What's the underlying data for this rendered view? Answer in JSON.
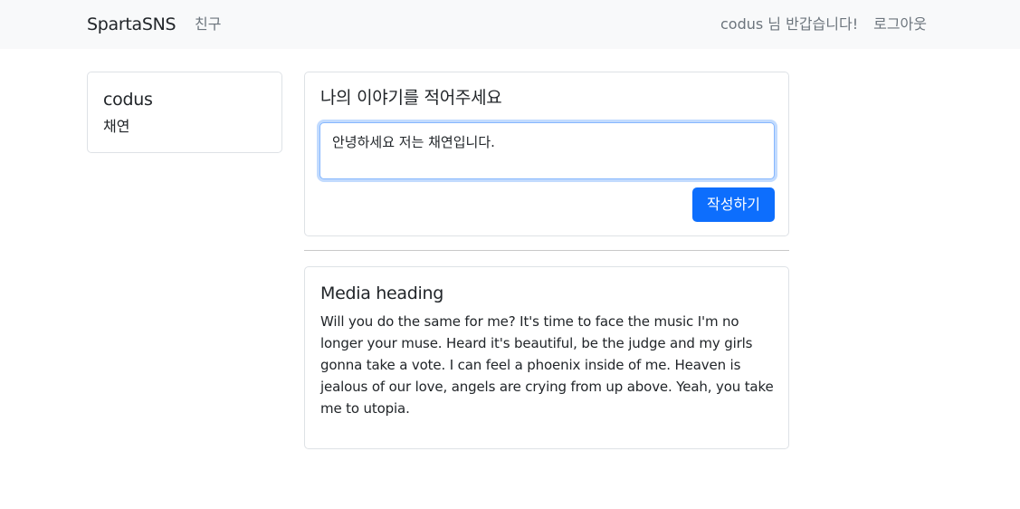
{
  "navbar": {
    "brand": "SpartaSNS",
    "friends_link": "친구",
    "greeting": "codus 님 반갑습니다!",
    "logout_link": "로그아웃",
    "background_color": "#f8f9fa"
  },
  "profile": {
    "username": "codus",
    "nickname": "채연"
  },
  "composer": {
    "title": "나의 이야기를 적어주세요",
    "input_value": "안녕하세요 저는 채연입니다.",
    "submit_label": "작성하기",
    "accent_color": "#0d6efd"
  },
  "posts": [
    {
      "title": "Media heading",
      "body": "Will you do the same for me? It's time to face the music I'm no longer your muse. Heard it's beautiful, be the judge and my girls gonna take a vote. I can feel a phoenix inside of me. Heaven is jealous of our love, angels are crying from up above. Yeah, you take me to utopia."
    }
  ]
}
